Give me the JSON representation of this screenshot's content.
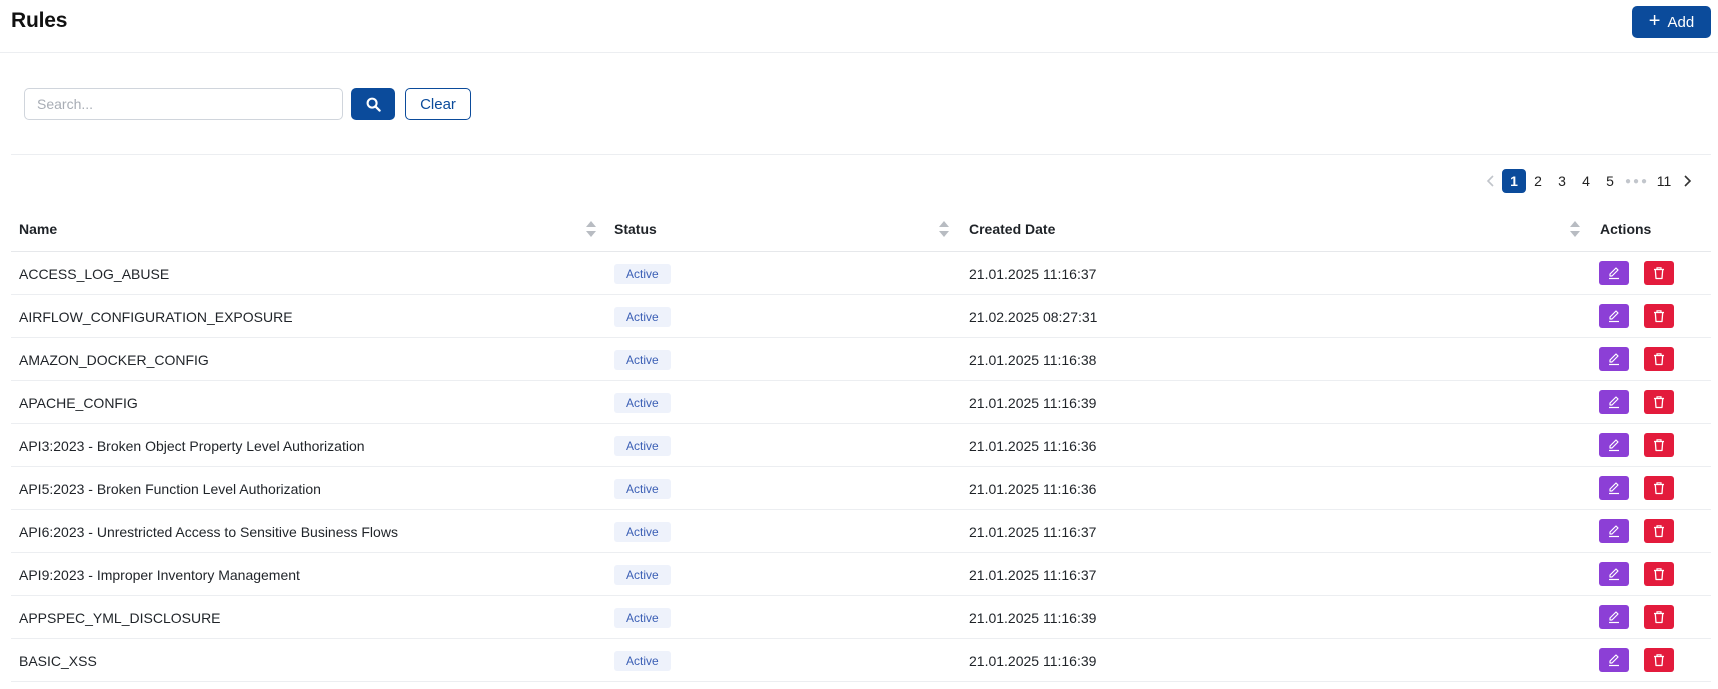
{
  "header": {
    "title": "Rules",
    "add_label": "Add"
  },
  "search": {
    "placeholder": "Search...",
    "value": "",
    "clear_label": "Clear"
  },
  "pagination": {
    "pages": [
      "1",
      "2",
      "3",
      "4",
      "5",
      "11"
    ],
    "current": "1"
  },
  "table": {
    "columns": [
      "Name",
      "Status",
      "Created Date",
      "Actions"
    ],
    "rows": [
      {
        "name": "ACCESS_LOG_ABUSE",
        "status": "Active",
        "created": "21.01.2025 11:16:37"
      },
      {
        "name": "AIRFLOW_CONFIGURATION_EXPOSURE",
        "status": "Active",
        "created": "21.02.2025 08:27:31"
      },
      {
        "name": "AMAZON_DOCKER_CONFIG",
        "status": "Active",
        "created": "21.01.2025 11:16:38"
      },
      {
        "name": "APACHE_CONFIG",
        "status": "Active",
        "created": "21.01.2025 11:16:39"
      },
      {
        "name": "API3:2023 - Broken Object Property Level Authorization",
        "status": "Active",
        "created": "21.01.2025 11:16:36"
      },
      {
        "name": "API5:2023 - Broken Function Level Authorization",
        "status": "Active",
        "created": "21.01.2025 11:16:36"
      },
      {
        "name": "API6:2023 - Unrestricted Access to Sensitive Business Flows",
        "status": "Active",
        "created": "21.01.2025 11:16:37"
      },
      {
        "name": "API9:2023 - Improper Inventory Management",
        "status": "Active",
        "created": "21.01.2025 11:16:37"
      },
      {
        "name": "APPSPEC_YML_DISCLOSURE",
        "status": "Active",
        "created": "21.01.2025 11:16:39"
      },
      {
        "name": "BASIC_XSS",
        "status": "Active",
        "created": "21.01.2025 11:16:39"
      }
    ]
  },
  "colors": {
    "primary": "#0b4b9b",
    "edit": "#8c3fd6",
    "delete": "#e31b3c",
    "badge_bg": "#eef2fb",
    "badge_text": "#3b5fb5"
  },
  "icons": {
    "add": "plus-icon",
    "search": "search-icon",
    "prev": "chevron-left-icon",
    "next": "chevron-right-icon",
    "sort": "sort-icon",
    "edit": "edit-icon",
    "delete": "trash-icon"
  }
}
